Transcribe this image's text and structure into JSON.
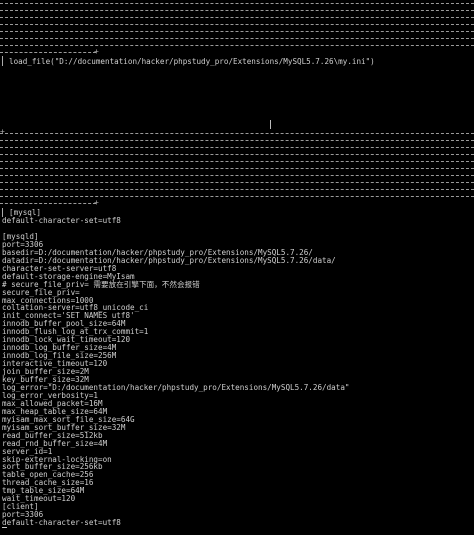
{
  "load_line": "load_file(\"D://documentation/hacker/phpstudy_pro/Extensions/MySQL5.7.26\\my.ini\")",
  "section_mysql": "[mysql]",
  "config_lines": [
    "default-character-set=utf8",
    "",
    "[mysqld]",
    "port=3306",
    "basedir=D:/documentation/hacker/phpstudy_pro/Extensions/MySQL5.7.26/",
    "datadir=D:/documentation/hacker/phpstudy_pro/Extensions/MySQL5.7.26/data/",
    "character-set-server=utf8",
    "default-storage-engine=MyIsam",
    "# secure_file_priv= 需要放在引擎下面，不然会报错",
    "secure_file_priv=",
    "max_connections=1000",
    "collation-server=utf8_unicode_ci",
    "init_connect='SET NAMES utf8'",
    "innodb_buffer_pool_size=64M",
    "innodb_flush_log_at_trx_commit=1",
    "innodb_lock_wait_timeout=120",
    "innodb_log_buffer_size=4M",
    "innodb_log_file_size=256M",
    "interactive_timeout=120",
    "join_buffer_size=2M",
    "key_buffer_size=32M",
    "log_error=\"D:/documentation/hacker/phpstudy_pro/Extensions/MySQL5.7.26/data\"",
    "log_error_verbosity=1",
    "max_allowed_packet=16M",
    "max_heap_table_size=64M",
    "myisam_max_sort_file_size=64G",
    "myisam_sort_buffer_size=32M",
    "read_buffer_size=512kb",
    "read_rnd_buffer_size=4M",
    "server_id=1",
    "skip-external-locking=on",
    "sort_buffer_size=256kb",
    "table_open_cache=256",
    "thread_cache_size=16",
    "tmp_table_size=64M",
    "wait_timeout=120",
    "[client]",
    "port=3306",
    "default-character-set=utf8"
  ]
}
